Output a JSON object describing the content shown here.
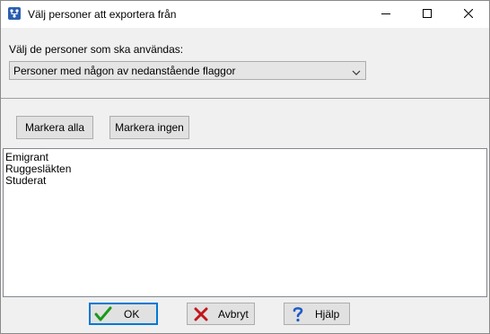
{
  "window": {
    "title": "Välj personer att exportera från",
    "app_icon": "family-tree-app-icon"
  },
  "window_controls": {
    "minimize_icon": "minimize-icon",
    "maximize_icon": "maximize-icon",
    "close_icon": "close-icon"
  },
  "selection": {
    "label": "Välj de personer som ska användas:",
    "combo_value": "Personer med någon av nedanstående flaggor",
    "combo_icon": "chevron-down-icon"
  },
  "actions": {
    "mark_all": "Markera alla",
    "mark_none": "Markera ingen"
  },
  "flags": [
    "Emigrant",
    "Ruggesläkten",
    "Studerat"
  ],
  "dialog_buttons": {
    "ok": "OK",
    "cancel": "Avbryt",
    "help": "Hjälp"
  },
  "colors": {
    "accent": "#0078d7",
    "ok_check": "#1a9a1a",
    "cancel_x": "#c0171b",
    "help_q": "#1e5bc6"
  }
}
